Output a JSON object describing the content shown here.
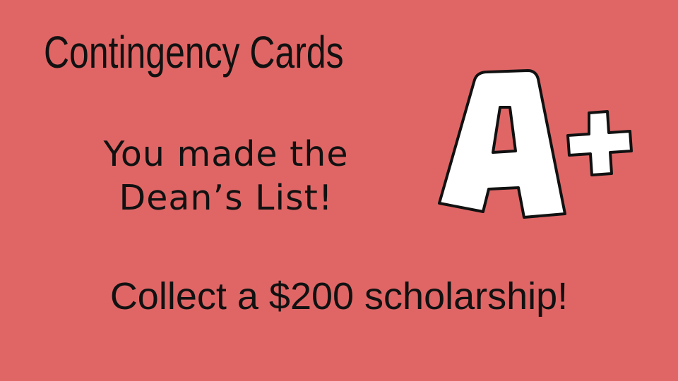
{
  "slide": {
    "title": "Contingency Cards",
    "message_lines": [
      "You made the",
      "Dean’s List!"
    ],
    "reward": "Collect a $200 scholarship!",
    "grade_icon": "a-plus-icon"
  },
  "colors": {
    "background": "#e06666",
    "text": "#111111",
    "grade_fill": "#ffffff",
    "grade_outline": "#111111"
  }
}
